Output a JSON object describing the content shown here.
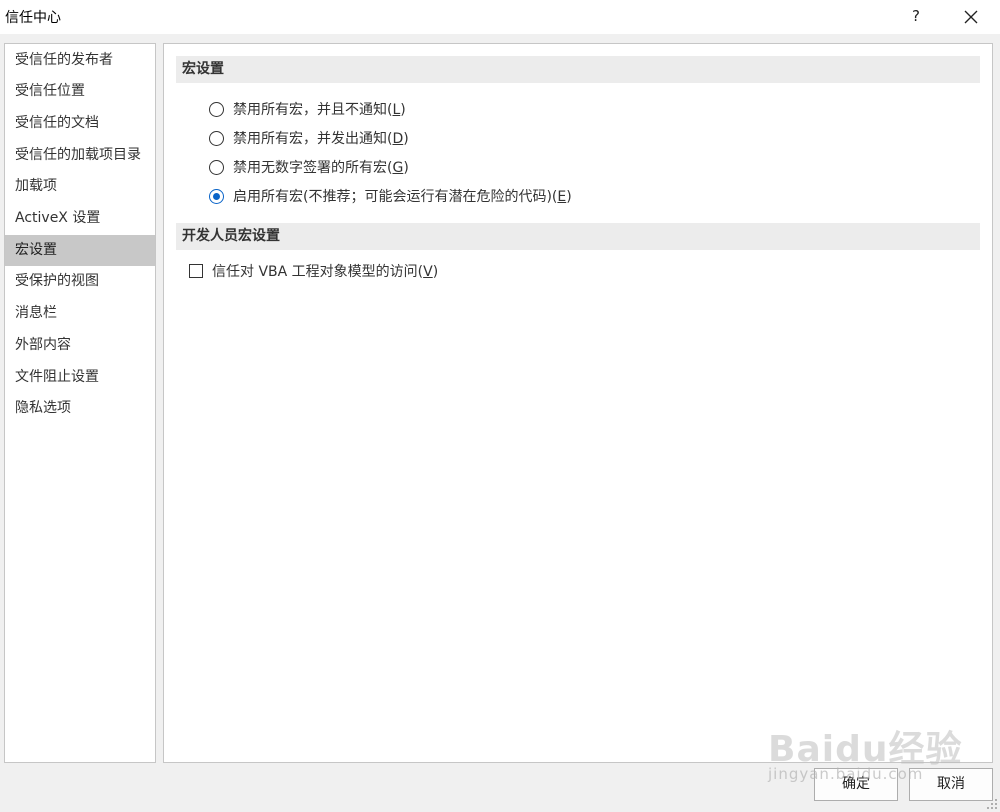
{
  "window": {
    "title": "信任中心",
    "help_label": "?"
  },
  "sidebar": {
    "items": [
      {
        "label": "受信任的发布者"
      },
      {
        "label": "受信任位置"
      },
      {
        "label": "受信任的文档"
      },
      {
        "label": "受信任的加载项目录"
      },
      {
        "label": "加载项"
      },
      {
        "label": "ActiveX 设置"
      },
      {
        "label": "宏设置",
        "selected": true
      },
      {
        "label": "受保护的视图"
      },
      {
        "label": "消息栏"
      },
      {
        "label": "外部内容"
      },
      {
        "label": "文件阻止设置"
      },
      {
        "label": "隐私选项"
      }
    ]
  },
  "macro_settings": {
    "header": "宏设置",
    "options": [
      {
        "label": "禁用所有宏，并且不通知(",
        "key": "L",
        "suffix": ")",
        "checked": false
      },
      {
        "label": "禁用所有宏，并发出通知(",
        "key": "D",
        "suffix": ")",
        "checked": false
      },
      {
        "label": "禁用无数字签署的所有宏(",
        "key": "G",
        "suffix": ")",
        "checked": false
      },
      {
        "label": "启用所有宏(不推荐；可能会运行有潜在危险的代码)(",
        "key": "E",
        "suffix": ")",
        "checked": true
      }
    ]
  },
  "developer_settings": {
    "header": "开发人员宏设置",
    "vba_access": {
      "label": "信任对 VBA 工程对象模型的访问(",
      "key": "V",
      "suffix": ")",
      "checked": false
    }
  },
  "buttons": {
    "ok": "确定",
    "cancel": "取消"
  },
  "watermark": {
    "logo": "Baidu经验",
    "url": "jingyan.baidu.com"
  },
  "colors": {
    "accent": "#0a64c8",
    "selected_bg": "#c8c8c8",
    "section_bg": "#ececec"
  }
}
